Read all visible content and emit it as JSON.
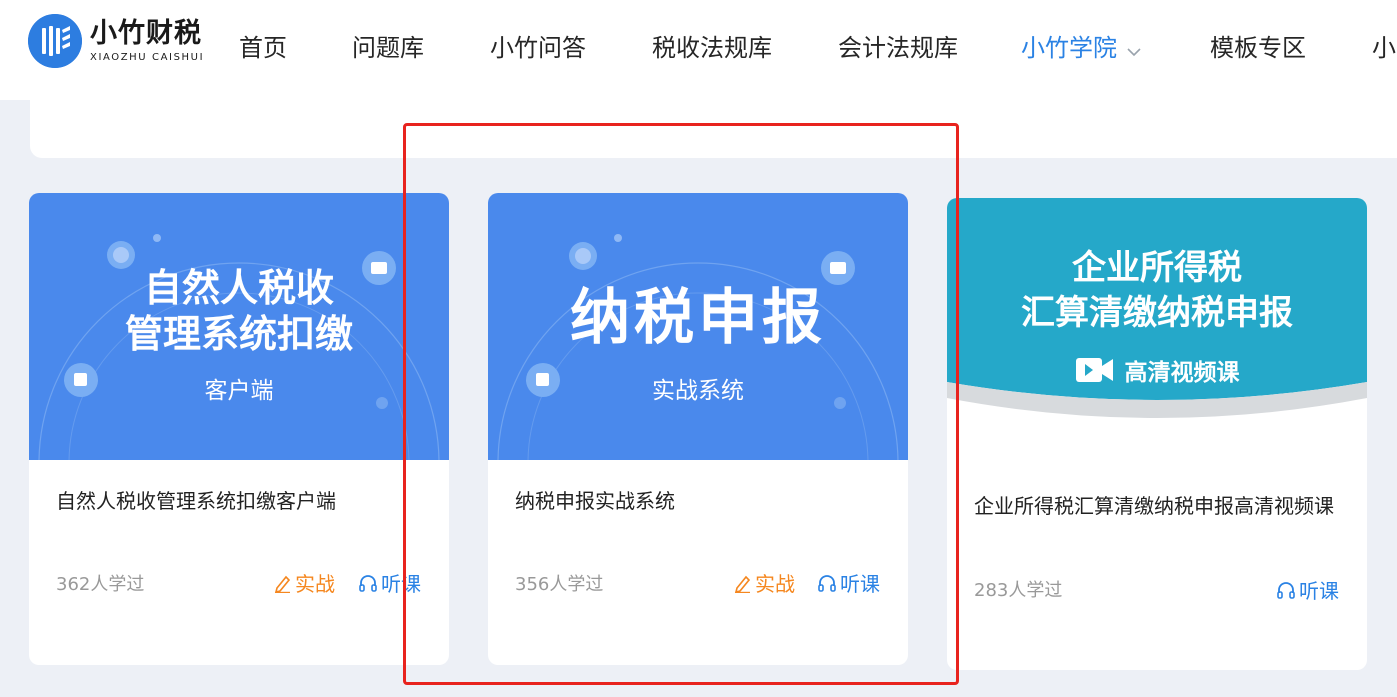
{
  "brand": {
    "name_cn": "小竹财税",
    "name_en": "XIAOZHU CAISHUI"
  },
  "nav": {
    "items": [
      {
        "label": "首页",
        "active": false
      },
      {
        "label": "问题库",
        "active": false
      },
      {
        "label": "小竹问答",
        "active": false
      },
      {
        "label": "税收法规库",
        "active": false
      },
      {
        "label": "会计法规库",
        "active": false
      },
      {
        "label": "小竹学院",
        "active": true,
        "has_dropdown": true
      },
      {
        "label": "模板专区",
        "active": false
      },
      {
        "label": "小",
        "active": false
      }
    ]
  },
  "colors": {
    "accent": "#2a82e4",
    "practice": "#f5871f",
    "banner_blue": "#4a89ec",
    "banner_teal": "#25a8c9",
    "highlight": "#e8231e"
  },
  "cards": [
    {
      "banner_title_lines": [
        "自然人税收",
        "管理系统扣缴"
      ],
      "banner_sub": "客户端",
      "title": "自然人税收管理系统扣缴客户端",
      "count": "362人学过",
      "practice_label": "实战",
      "listen_label": "听课"
    },
    {
      "banner_title_lines": [
        "纳税申报"
      ],
      "banner_sub": "实战系统",
      "title": "纳税申报实战系统",
      "count": "356人学过",
      "practice_label": "实战",
      "listen_label": "听课"
    },
    {
      "banner_title_lines": [
        "企业所得税",
        "汇算清缴纳税申报"
      ],
      "banner_sub": "高清视频课",
      "title": "企业所得税汇算清缴纳税申报高清视频课",
      "count": "283人学过",
      "listen_label": "听课"
    }
  ]
}
